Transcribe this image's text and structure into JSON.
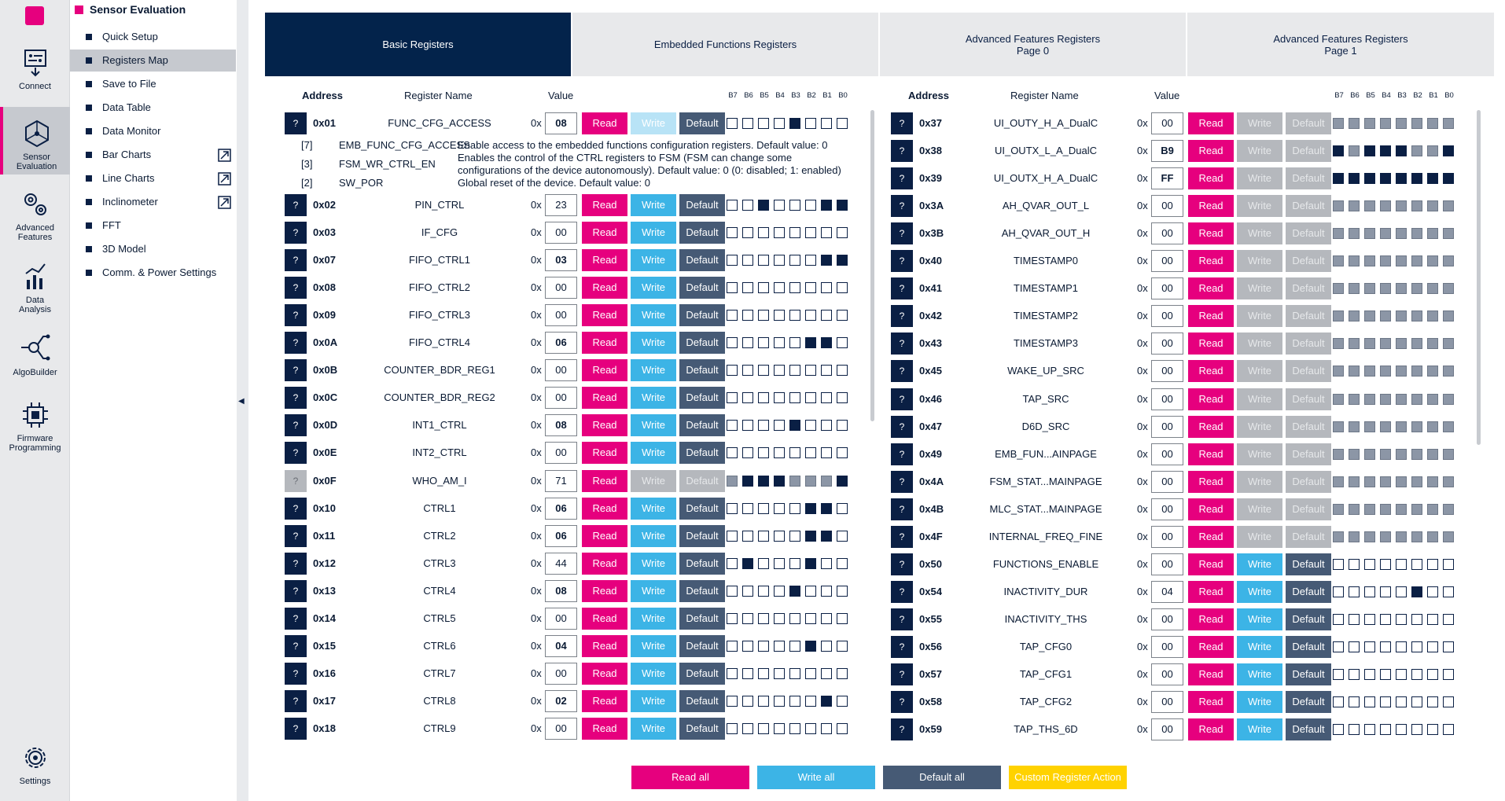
{
  "rail": [
    {
      "label": "Connect",
      "icon": "connect-icon"
    },
    {
      "label": "Sensor Evaluation",
      "icon": "sensor-evaluation-icon",
      "active": true
    },
    {
      "label": "Advanced Features",
      "icon": "advanced-features-icon"
    },
    {
      "label": "Data Analysis",
      "icon": "data-analysis-icon"
    },
    {
      "label": "AlgoBuilder",
      "icon": "algobuilder-icon"
    },
    {
      "label": "Firmware Programming",
      "icon": "firmware-programming-icon"
    },
    {
      "label": "Settings",
      "icon": "settings-icon"
    }
  ],
  "menu": {
    "title": "Sensor Evaluation",
    "items": [
      {
        "label": "Quick Setup"
      },
      {
        "label": "Registers Map",
        "active": true
      },
      {
        "label": "Save to File"
      },
      {
        "label": "Data Table"
      },
      {
        "label": "Data Monitor"
      },
      {
        "label": "Bar Charts",
        "external": true
      },
      {
        "label": "Line Charts",
        "external": true
      },
      {
        "label": "Inclinometer",
        "external": true
      },
      {
        "label": "FFT"
      },
      {
        "label": "3D Model"
      },
      {
        "label": "Comm. & Power Settings"
      }
    ]
  },
  "tabs": [
    {
      "label": "Basic Registers",
      "active": true
    },
    {
      "label": "Embedded Functions Registers"
    },
    {
      "label": "Advanced Features Registers\nPage 0"
    },
    {
      "label": "Advanced Features Registers\nPage 1"
    }
  ],
  "headers": {
    "address": "Address",
    "register_name": "Register Name",
    "value": "Value",
    "bits": [
      "B7",
      "B6",
      "B5",
      "B4",
      "B3",
      "B2",
      "B1",
      "B0"
    ]
  },
  "prefix": "0x",
  "buttons": {
    "read": "Read",
    "write": "Write",
    "default": "Default",
    "help": "?"
  },
  "detail": {
    "bits": [
      {
        "bit": "[7]",
        "name": "EMB_FUNC_CFG_ACCESS",
        "desc": "Enable access to the embedded functions configuration registers. Default value: 0"
      },
      {
        "bit": "[3]",
        "name": "FSM_WR_CTRL_EN",
        "desc": "Enables the control of the CTRL registers to FSM (FSM can change some configurations of the device autonomously). Default value: 0 (0: disabled; 1: enabled)"
      },
      {
        "bit": "[2]",
        "name": "SW_POR",
        "desc": "Global reset of the device. Default value: 0"
      }
    ]
  },
  "left_registers": [
    {
      "addr": "0x01",
      "name": "FUNC_CFG_ACCESS",
      "value": "08",
      "bold": true,
      "write": "disabled",
      "bits": "00001000"
    },
    {
      "addr": "0x02",
      "name": "PIN_CTRL",
      "value": "23",
      "bold": false,
      "write": "on",
      "bits": "00100011"
    },
    {
      "addr": "0x03",
      "name": "IF_CFG",
      "value": "00",
      "bold": false,
      "write": "on",
      "bits": "00000000"
    },
    {
      "addr": "0x07",
      "name": "FIFO_CTRL1",
      "value": "03",
      "bold": true,
      "write": "on",
      "bits": "00000011"
    },
    {
      "addr": "0x08",
      "name": "FIFO_CTRL2",
      "value": "00",
      "bold": false,
      "write": "on",
      "bits": "00000000"
    },
    {
      "addr": "0x09",
      "name": "FIFO_CTRL3",
      "value": "00",
      "bold": false,
      "write": "on",
      "bits": "00000000"
    },
    {
      "addr": "0x0A",
      "name": "FIFO_CTRL4",
      "value": "06",
      "bold": true,
      "write": "on",
      "bits": "00000110"
    },
    {
      "addr": "0x0B",
      "name": "COUNTER_BDR_REG1",
      "value": "00",
      "bold": false,
      "write": "on",
      "bits": "00000000"
    },
    {
      "addr": "0x0C",
      "name": "COUNTER_BDR_REG2",
      "value": "00",
      "bold": false,
      "write": "on",
      "bits": "00000000"
    },
    {
      "addr": "0x0D",
      "name": "INT1_CTRL",
      "value": "08",
      "bold": true,
      "write": "on",
      "bits": "00001000"
    },
    {
      "addr": "0x0E",
      "name": "INT2_CTRL",
      "value": "00",
      "bold": false,
      "write": "on",
      "bits": "00000000"
    },
    {
      "addr": "0x0F",
      "name": "WHO_AM_I",
      "value": "71",
      "bold": false,
      "write": "readonly",
      "bits": "01110001"
    },
    {
      "addr": "0x10",
      "name": "CTRL1",
      "value": "06",
      "bold": true,
      "write": "on",
      "bits": "00000110"
    },
    {
      "addr": "0x11",
      "name": "CTRL2",
      "value": "06",
      "bold": true,
      "write": "on",
      "bits": "00000110"
    },
    {
      "addr": "0x12",
      "name": "CTRL3",
      "value": "44",
      "bold": false,
      "write": "on",
      "bits": "01000100"
    },
    {
      "addr": "0x13",
      "name": "CTRL4",
      "value": "08",
      "bold": true,
      "write": "on",
      "bits": "00001000"
    },
    {
      "addr": "0x14",
      "name": "CTRL5",
      "value": "00",
      "bold": false,
      "write": "on",
      "bits": "00000000"
    },
    {
      "addr": "0x15",
      "name": "CTRL6",
      "value": "04",
      "bold": true,
      "write": "on",
      "bits": "00000100"
    },
    {
      "addr": "0x16",
      "name": "CTRL7",
      "value": "00",
      "bold": false,
      "write": "on",
      "bits": "00000000"
    },
    {
      "addr": "0x17",
      "name": "CTRL8",
      "value": "02",
      "bold": true,
      "write": "on",
      "bits": "00000010"
    },
    {
      "addr": "0x18",
      "name": "CTRL9",
      "value": "00",
      "bold": false,
      "write": "on",
      "bits": "00000000"
    }
  ],
  "right_registers": [
    {
      "addr": "0x37",
      "name": "UI_OUTY_H_A_DualC",
      "value": "00",
      "bold": false,
      "write": "readonly",
      "bits": "00000000"
    },
    {
      "addr": "0x38",
      "name": "UI_OUTX_L_A_DualC",
      "value": "B9",
      "bold": true,
      "write": "readonly",
      "bits": "10111001"
    },
    {
      "addr": "0x39",
      "name": "UI_OUTX_H_A_DualC",
      "value": "FF",
      "bold": true,
      "write": "readonly",
      "bits": "11111111"
    },
    {
      "addr": "0x3A",
      "name": "AH_QVAR_OUT_L",
      "value": "00",
      "bold": false,
      "write": "readonly",
      "bits": "00000000"
    },
    {
      "addr": "0x3B",
      "name": "AH_QVAR_OUT_H",
      "value": "00",
      "bold": false,
      "write": "readonly",
      "bits": "00000000"
    },
    {
      "addr": "0x40",
      "name": "TIMESTAMP0",
      "value": "00",
      "bold": false,
      "write": "readonly",
      "bits": "00000000"
    },
    {
      "addr": "0x41",
      "name": "TIMESTAMP1",
      "value": "00",
      "bold": false,
      "write": "readonly",
      "bits": "00000000"
    },
    {
      "addr": "0x42",
      "name": "TIMESTAMP2",
      "value": "00",
      "bold": false,
      "write": "readonly",
      "bits": "00000000"
    },
    {
      "addr": "0x43",
      "name": "TIMESTAMP3",
      "value": "00",
      "bold": false,
      "write": "readonly",
      "bits": "00000000"
    },
    {
      "addr": "0x45",
      "name": "WAKE_UP_SRC",
      "value": "00",
      "bold": false,
      "write": "readonly",
      "bits": "00000000"
    },
    {
      "addr": "0x46",
      "name": "TAP_SRC",
      "value": "00",
      "bold": false,
      "write": "readonly",
      "bits": "00000000"
    },
    {
      "addr": "0x47",
      "name": "D6D_SRC",
      "value": "00",
      "bold": false,
      "write": "readonly",
      "bits": "00000000"
    },
    {
      "addr": "0x49",
      "name": "EMB_FUN...AINPAGE",
      "value": "00",
      "bold": false,
      "write": "readonly",
      "bits": "00000000"
    },
    {
      "addr": "0x4A",
      "name": "FSM_STAT...MAINPAGE",
      "value": "00",
      "bold": false,
      "write": "readonly",
      "bits": "00000000"
    },
    {
      "addr": "0x4B",
      "name": "MLC_STAT...MAINPAGE",
      "value": "00",
      "bold": false,
      "write": "readonly",
      "bits": "00000000"
    },
    {
      "addr": "0x4F",
      "name": "INTERNAL_FREQ_FINE",
      "value": "00",
      "bold": false,
      "write": "readonly",
      "bits": "00000000"
    },
    {
      "addr": "0x50",
      "name": "FUNCTIONS_ENABLE",
      "value": "00",
      "bold": false,
      "write": "on",
      "bits": "00000000"
    },
    {
      "addr": "0x54",
      "name": "INACTIVITY_DUR",
      "value": "04",
      "bold": false,
      "write": "on",
      "bits": "00000100"
    },
    {
      "addr": "0x55",
      "name": "INACTIVITY_THS",
      "value": "00",
      "bold": false,
      "write": "on",
      "bits": "00000000"
    },
    {
      "addr": "0x56",
      "name": "TAP_CFG0",
      "value": "00",
      "bold": false,
      "write": "on",
      "bits": "00000000"
    },
    {
      "addr": "0x57",
      "name": "TAP_CFG1",
      "value": "00",
      "bold": false,
      "write": "on",
      "bits": "00000000"
    },
    {
      "addr": "0x58",
      "name": "TAP_CFG2",
      "value": "00",
      "bold": false,
      "write": "on",
      "bits": "00000000"
    },
    {
      "addr": "0x59",
      "name": "TAP_THS_6D",
      "value": "00",
      "bold": false,
      "write": "on",
      "bits": "00000000"
    }
  ],
  "bottom": {
    "read_all": "Read all",
    "write_all": "Write all",
    "default_all": "Default all",
    "custom_action": "Custom Register Action"
  },
  "colors": {
    "accent": "#e6007e",
    "navy": "#03234b",
    "write": "#3cb4e6",
    "default": "#465a75",
    "custom": "#ffd200"
  }
}
